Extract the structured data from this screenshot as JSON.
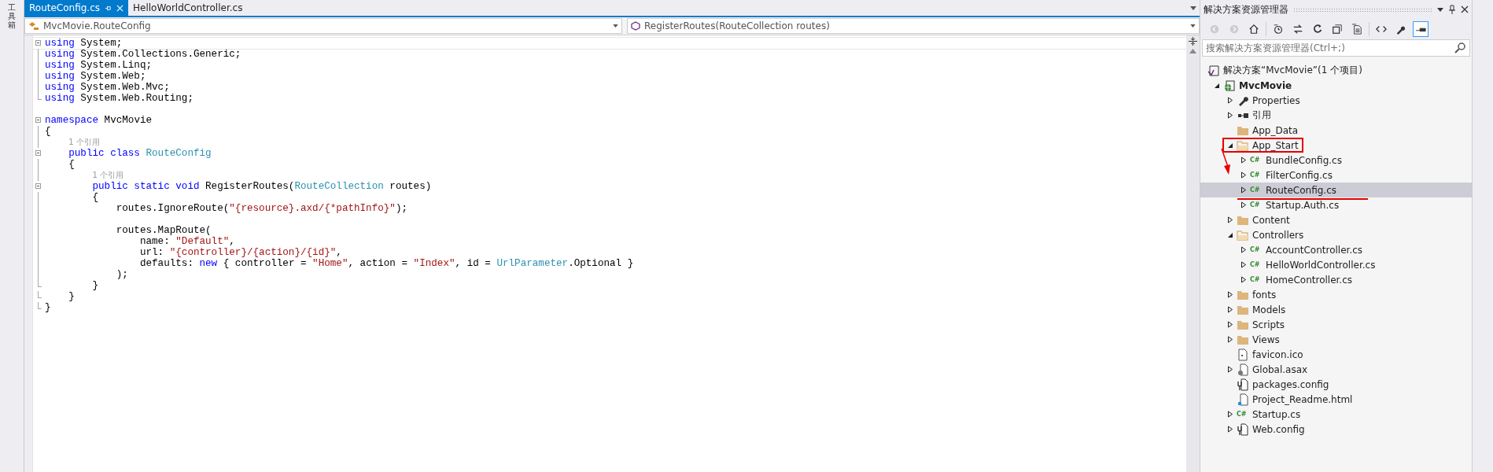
{
  "left_strip": {
    "label": "工具箱"
  },
  "tabs": [
    {
      "label": "RouteConfig.cs",
      "selected": true
    },
    {
      "label": "HelloWorldController.cs",
      "selected": false
    }
  ],
  "nav": {
    "type_dropdown": "MvcMovie.RouteConfig",
    "member_dropdown": "RegisterRoutes(RouteCollection routes)"
  },
  "code_lines": [
    {
      "kind": "fold-start",
      "tokens": [
        {
          "kind": "keyword",
          "text": "using"
        },
        {
          "kind": "plain",
          "text": " System;"
        }
      ]
    },
    {
      "kind": "fold-body",
      "tokens": [
        {
          "kind": "keyword",
          "text": "using"
        },
        {
          "kind": "plain",
          "text": " System.Collections.Generic;"
        }
      ]
    },
    {
      "kind": "fold-body",
      "tokens": [
        {
          "kind": "keyword",
          "text": "using"
        },
        {
          "kind": "plain",
          "text": " System.Linq;"
        }
      ]
    },
    {
      "kind": "fold-body",
      "tokens": [
        {
          "kind": "keyword",
          "text": "using"
        },
        {
          "kind": "plain",
          "text": " System.Web;"
        }
      ]
    },
    {
      "kind": "fold-body",
      "tokens": [
        {
          "kind": "keyword",
          "text": "using"
        },
        {
          "kind": "plain",
          "text": " System.Web.Mvc;"
        }
      ]
    },
    {
      "kind": "fold-end",
      "tokens": [
        {
          "kind": "keyword",
          "text": "using"
        },
        {
          "kind": "plain",
          "text": " System.Web.Routing;"
        }
      ]
    },
    {
      "kind": "blank"
    },
    {
      "kind": "fold-start",
      "tokens": [
        {
          "kind": "keyword",
          "text": "namespace"
        },
        {
          "kind": "plain",
          "text": " MvcMovie"
        }
      ]
    },
    {
      "kind": "fold-body",
      "tokens": [
        {
          "kind": "plain",
          "text": "{"
        }
      ]
    },
    {
      "kind": "fold-body",
      "tokens": [
        {
          "kind": "lens",
          "text": "1 个引用"
        }
      ]
    },
    {
      "kind": "fold-start",
      "tokens": [
        {
          "kind": "keyword",
          "text": "    public class"
        },
        {
          "kind": "type",
          "text": " RouteConfig"
        }
      ]
    },
    {
      "kind": "fold-body",
      "tokens": [
        {
          "kind": "plain",
          "text": "    {"
        }
      ]
    },
    {
      "kind": "fold-body",
      "tokens": [
        {
          "kind": "lens",
          "text": "1 个引用"
        }
      ]
    },
    {
      "kind": "fold-start",
      "tokens": [
        {
          "kind": "keyword",
          "text": "        public static void"
        },
        {
          "kind": "plain",
          "text": " RegisterRoutes("
        },
        {
          "kind": "type",
          "text": "RouteCollection"
        },
        {
          "kind": "plain",
          "text": " routes)"
        }
      ]
    },
    {
      "kind": "fold-body",
      "tokens": [
        {
          "kind": "plain",
          "text": "        {"
        }
      ]
    },
    {
      "kind": "fold-body",
      "tokens": [
        {
          "kind": "plain",
          "text": "            routes.IgnoreRoute("
        },
        {
          "kind": "string",
          "text": "\"{resource}.axd/{*pathInfo}\""
        },
        {
          "kind": "plain",
          "text": ");"
        }
      ]
    },
    {
      "kind": "fold-body"
    },
    {
      "kind": "fold-body",
      "tokens": [
        {
          "kind": "plain",
          "text": "            routes.MapRoute("
        }
      ]
    },
    {
      "kind": "fold-body",
      "tokens": [
        {
          "kind": "plain",
          "text": "                name: "
        },
        {
          "kind": "string",
          "text": "\"Default\""
        },
        {
          "kind": "plain",
          "text": ","
        }
      ]
    },
    {
      "kind": "fold-body",
      "tokens": [
        {
          "kind": "plain",
          "text": "                url: "
        },
        {
          "kind": "string",
          "text": "\"{controller}/{action}/{id}\""
        },
        {
          "kind": "plain",
          "text": ","
        }
      ]
    },
    {
      "kind": "fold-body",
      "tokens": [
        {
          "kind": "plain",
          "text": "                defaults: "
        },
        {
          "kind": "keyword",
          "text": "new"
        },
        {
          "kind": "plain",
          "text": " { controller = "
        },
        {
          "kind": "string",
          "text": "\"Home\""
        },
        {
          "kind": "plain",
          "text": ", action = "
        },
        {
          "kind": "string",
          "text": "\"Index\""
        },
        {
          "kind": "plain",
          "text": ", id = "
        },
        {
          "kind": "type",
          "text": "UrlParameter"
        },
        {
          "kind": "plain",
          "text": ".Optional }"
        }
      ]
    },
    {
      "kind": "fold-body",
      "tokens": [
        {
          "kind": "plain",
          "text": "            );"
        }
      ]
    },
    {
      "kind": "fold-end",
      "tokens": [
        {
          "kind": "plain",
          "text": "        }"
        }
      ]
    },
    {
      "kind": "fold-end",
      "tokens": [
        {
          "kind": "plain",
          "text": "    }"
        }
      ]
    },
    {
      "kind": "fold-end",
      "tokens": [
        {
          "kind": "plain",
          "text": "}"
        }
      ]
    }
  ],
  "solution_explorer": {
    "title": "解决方案资源管理器",
    "search": {
      "placeholder": "搜索解决方案资源管理器(Ctrl+;)"
    },
    "solution": {
      "label": "解决方案“MvcMovie”(1 个项目)"
    },
    "tree": [
      {
        "label": "MvcMovie",
        "kind": "project",
        "bold": true,
        "expanded": true,
        "selected": false,
        "children": [
          {
            "label": "Properties",
            "kind": "properties",
            "expanded": false,
            "selected": false
          },
          {
            "label": "引用",
            "kind": "references",
            "expanded": false,
            "selected": false
          },
          {
            "label": "App_Data",
            "kind": "folder",
            "selected": false
          },
          {
            "label": "App_Start",
            "kind": "open-folder",
            "expanded": true,
            "selected": false,
            "boxed": true,
            "children": [
              {
                "label": "BundleConfig.cs",
                "kind": "csharp",
                "badge": "C#",
                "expanded": false,
                "selected": false
              },
              {
                "label": "FilterConfig.cs",
                "kind": "csharp",
                "badge": "C#",
                "expanded": false,
                "selected": false
              },
              {
                "label": "RouteConfig.cs",
                "kind": "csharp",
                "badge": "C#",
                "expanded": false,
                "selected": true,
                "underlined": true
              },
              {
                "label": "Startup.Auth.cs",
                "kind": "csharp",
                "badge": "C#",
                "expanded": false,
                "selected": false
              }
            ]
          },
          {
            "label": "Content",
            "kind": "folder",
            "expanded": false,
            "selected": false
          },
          {
            "label": "Controllers",
            "kind": "open-folder",
            "expanded": true,
            "selected": false,
            "children": [
              {
                "label": "AccountController.cs",
                "kind": "csharp",
                "badge": "C#",
                "expanded": false,
                "selected": false
              },
              {
                "label": "HelloWorldController.cs",
                "kind": "csharp",
                "badge": "C#",
                "expanded": false,
                "selected": false
              },
              {
                "label": "HomeController.cs",
                "kind": "csharp",
                "badge": "C#",
                "expanded": false,
                "selected": false
              }
            ]
          },
          {
            "label": "fonts",
            "kind": "folder",
            "expanded": false,
            "selected": false
          },
          {
            "label": "Models",
            "kind": "folder",
            "expanded": false,
            "selected": false
          },
          {
            "label": "Scripts",
            "kind": "folder",
            "expanded": false,
            "selected": false
          },
          {
            "label": "Views",
            "kind": "folder",
            "expanded": false,
            "selected": false
          },
          {
            "label": "favicon.ico",
            "kind": "image",
            "selected": false
          },
          {
            "label": "Global.asax",
            "kind": "global",
            "expanded": false,
            "selected": false
          },
          {
            "label": "packages.config",
            "kind": "config",
            "selected": false
          },
          {
            "label": "Project_Readme.html",
            "kind": "html",
            "selected": false
          },
          {
            "label": "Startup.cs",
            "kind": "csharp",
            "badge": "C#",
            "expanded": false,
            "selected": false
          },
          {
            "label": "Web.config",
            "kind": "config",
            "expanded": false,
            "selected": false
          }
        ]
      }
    ]
  }
}
